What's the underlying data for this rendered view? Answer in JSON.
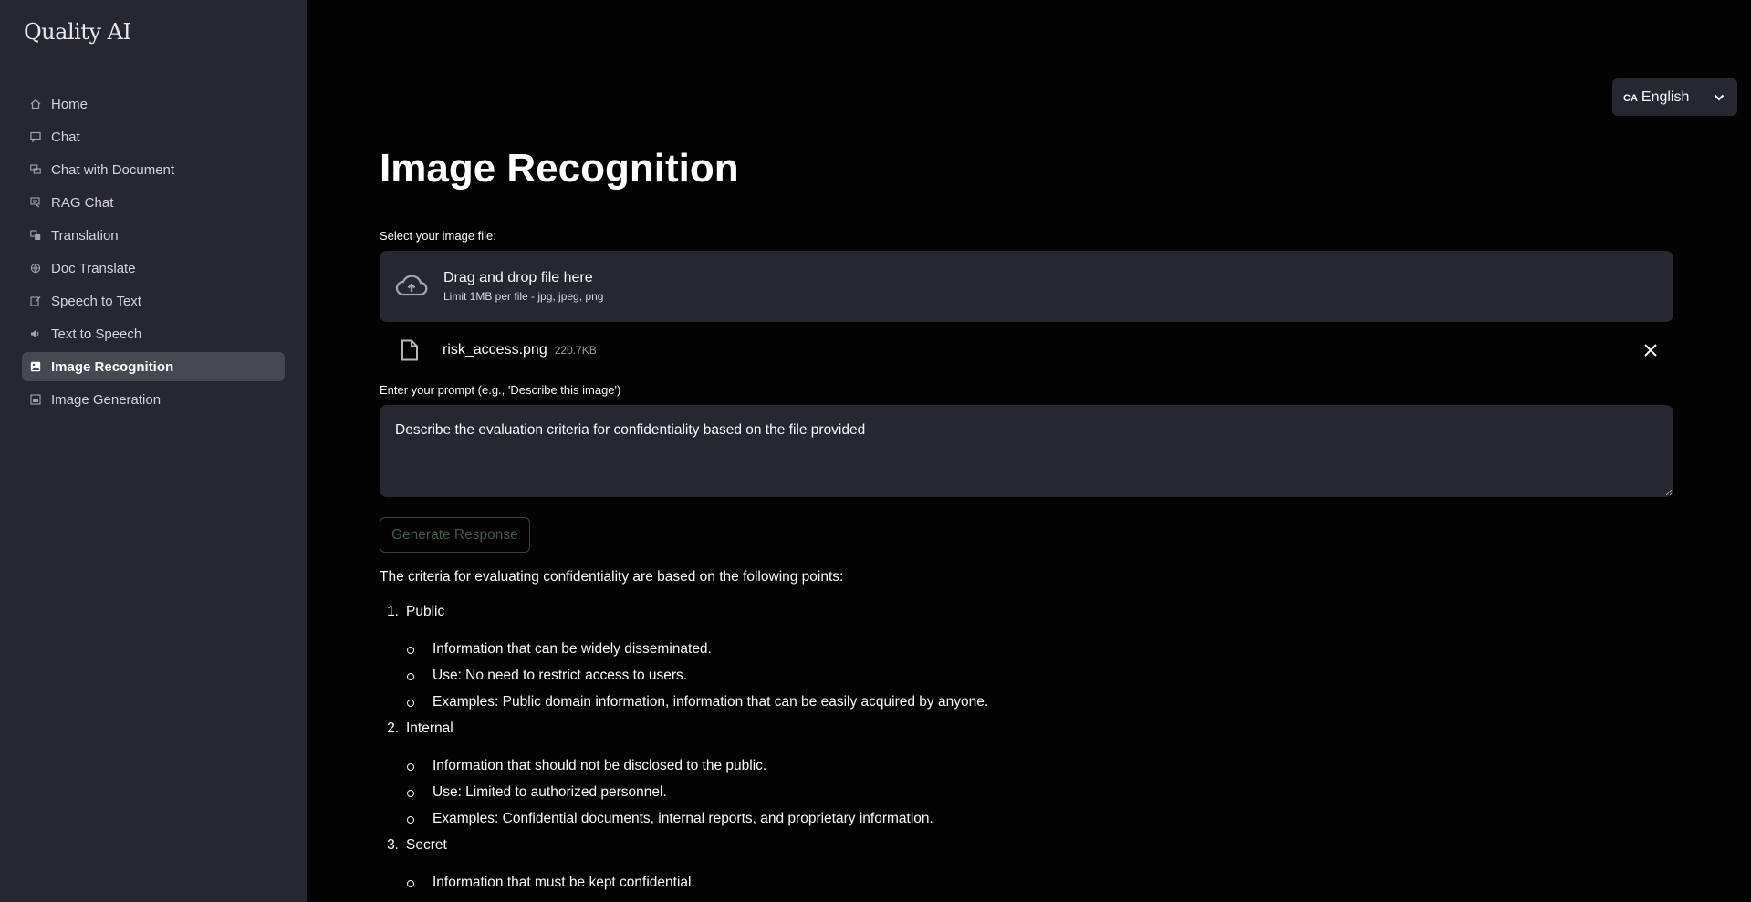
{
  "sidebar": {
    "brand": "Quality AI",
    "items": [
      {
        "label": "Home",
        "icon": "home-icon",
        "active": false
      },
      {
        "label": "Chat",
        "icon": "chat-icon",
        "active": false
      },
      {
        "label": "Chat with Document",
        "icon": "chat-document-icon",
        "active": false
      },
      {
        "label": "RAG Chat",
        "icon": "rag-chat-icon",
        "active": false
      },
      {
        "label": "Translation",
        "icon": "translation-icon",
        "active": false
      },
      {
        "label": "Doc Translate",
        "icon": "doc-translate-icon",
        "active": false
      },
      {
        "label": "Speech to Text",
        "icon": "speech-to-text-icon",
        "active": false
      },
      {
        "label": "Text to Speech",
        "icon": "text-to-speech-icon",
        "active": false
      },
      {
        "label": "Image Recognition",
        "icon": "image-recognition-icon",
        "active": true
      },
      {
        "label": "Image Generation",
        "icon": "image-generation-icon",
        "active": false
      }
    ]
  },
  "language": {
    "code": "CA",
    "label": "English"
  },
  "main": {
    "title": "Image Recognition",
    "file_label": "Select your image file:",
    "dropzone_title": "Drag and drop file here",
    "dropzone_sub": "Limit 1MB per file - jpg, jpeg, png",
    "file_name": "risk_access.png",
    "file_size": "220.7KB",
    "prompt_label": "Enter your prompt (e.g., 'Describe this image')",
    "prompt_value": "Describe the evaluation criteria for confidentiality based on the file provided",
    "generate_label": "Generate Response",
    "response_intro": "The criteria for evaluating confidentiality are based on the following points:",
    "criteria": [
      {
        "num": "1.",
        "title": "Public",
        "points": [
          "Information that can be widely disseminated.",
          "Use: No need to restrict access to users.",
          "Examples: Public domain information, information that can be easily acquired by anyone."
        ]
      },
      {
        "num": "2.",
        "title": "Internal",
        "points": [
          "Information that should not be disclosed to the public.",
          "Use: Limited to authorized personnel.",
          "Examples: Confidential documents, internal reports, and proprietary information."
        ]
      },
      {
        "num": "3.",
        "title": "Secret",
        "points": [
          "Information that must be kept confidential."
        ]
      }
    ]
  },
  "colors": {
    "sidebar_bg": "#262730",
    "main_bg": "#030303",
    "active_item_bg": "#464852",
    "button_text": "#3f5a48"
  }
}
